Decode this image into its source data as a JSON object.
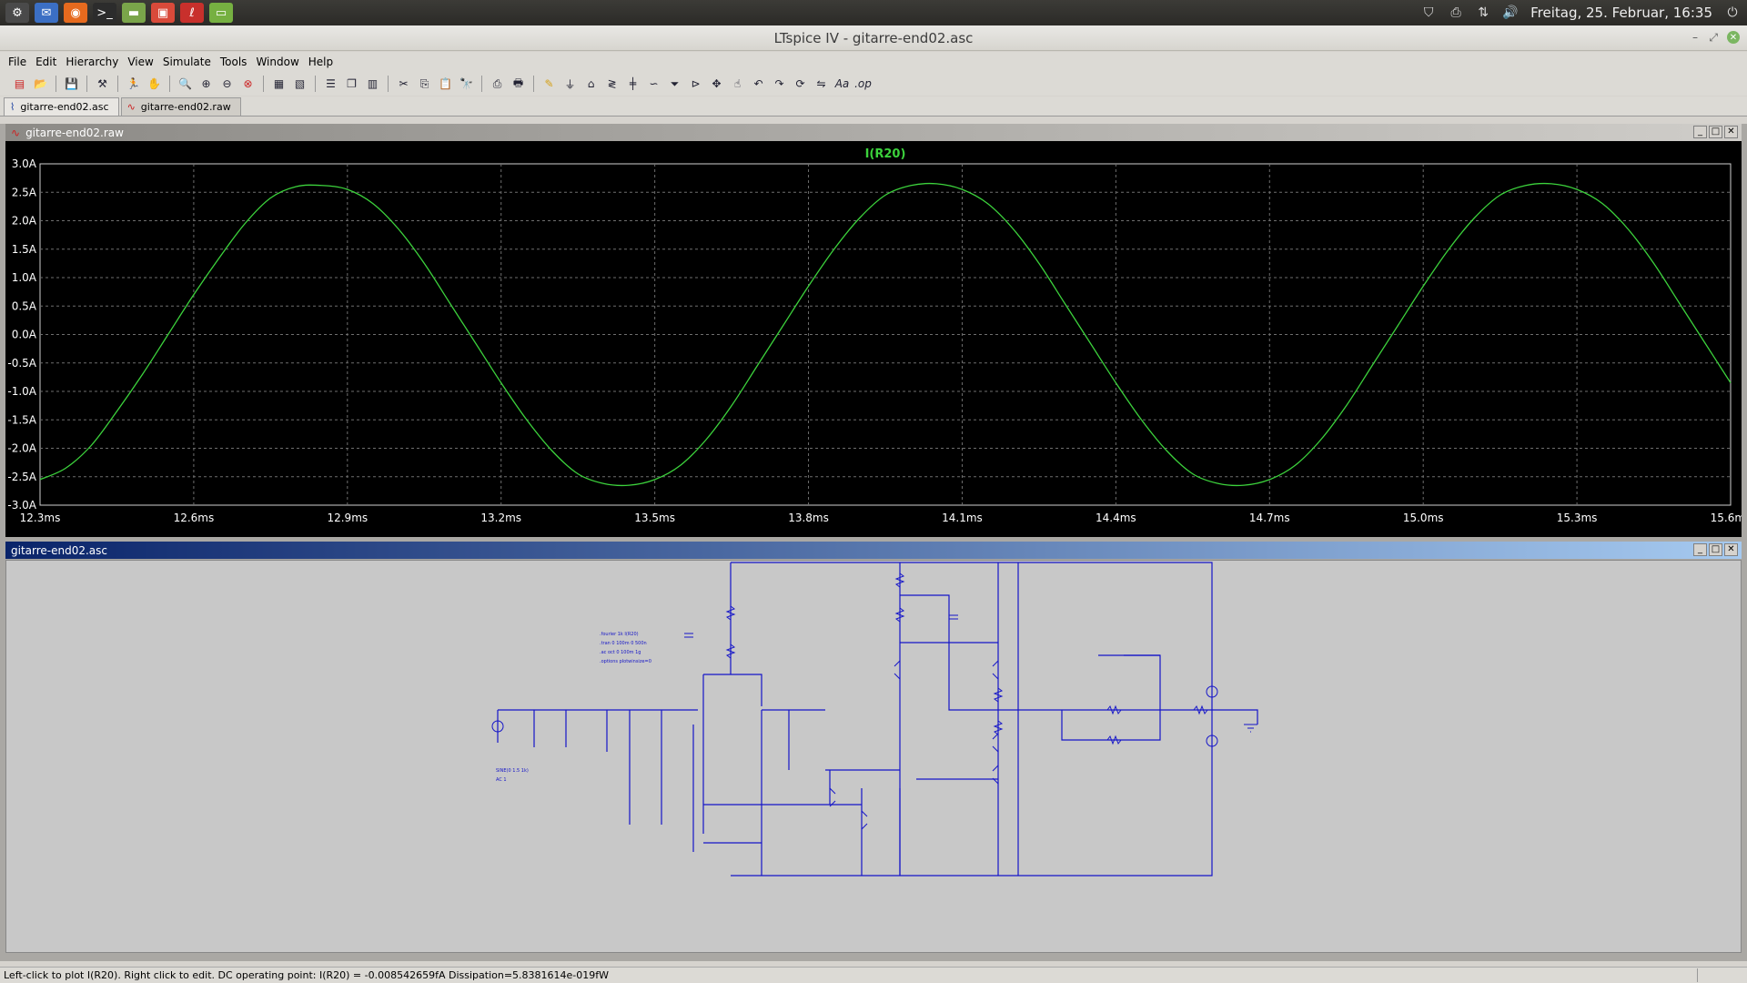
{
  "top_panel": {
    "launchers": [
      {
        "name": "system-settings-icon",
        "glyph": "⚙",
        "color": "#4a4a4a"
      },
      {
        "name": "mail-icon",
        "glyph": "✉",
        "color": "#3b6fc4"
      },
      {
        "name": "firefox-icon",
        "glyph": "◉",
        "color": "#e66a1e"
      },
      {
        "name": "terminal-icon",
        "glyph": ">_",
        "color": "#2c2c2c"
      },
      {
        "name": "files-icon",
        "glyph": "▬",
        "color": "#7aa54a"
      },
      {
        "name": "software-center-icon",
        "glyph": "▣",
        "color": "#d94a3a"
      },
      {
        "name": "ltspice-icon",
        "glyph": "ℓ",
        "color": "#c8302c"
      },
      {
        "name": "file-manager-icon",
        "glyph": "▭",
        "color": "#76b041"
      }
    ],
    "clock": "Freitag, 25. Februar, 16:35"
  },
  "window": {
    "title": "LTspice IV - gitarre-end02.asc",
    "minimize": "–",
    "restore": "⤢",
    "close": "✕"
  },
  "menu": [
    "File",
    "Edit",
    "Hierarchy",
    "View",
    "Simulate",
    "Tools",
    "Window",
    "Help"
  ],
  "tabs": [
    {
      "label": "gitarre-end02.asc",
      "icon": "schematic-icon",
      "glyph": "⌇"
    },
    {
      "label": "gitarre-end02.raw",
      "icon": "waveform-icon",
      "glyph": "∿"
    }
  ],
  "waveform_window": {
    "title": "gitarre-end02.raw",
    "trace_label": "I(R20)"
  },
  "schematic_window": {
    "title": "gitarre-end02.asc",
    "directives": [
      ".fourier 1k I(R20)",
      ".tran 0 100m 0 500n",
      ".ac oct 0 100m 1g",
      ".options plotwinsize=0"
    ],
    "source_lines": [
      "SINE(0 1.5 1k)",
      "AC 1"
    ]
  },
  "status": {
    "text": "Left-click to plot I(R20).  Right click to edit.  DC operating point: I(R20) = -0.008542659fA   Dissipation=5.8381614e-019fW"
  },
  "colors": {
    "trace": "#3cd23c",
    "grid": "#6e6e6e",
    "wire": "#1515c8",
    "label_green": "#3cd23c"
  },
  "chart_data": {
    "type": "line",
    "title": "I(R20)",
    "xlabel": "",
    "ylabel": "",
    "xlim": [
      12.3,
      15.6
    ],
    "ylim": [
      -3.0,
      3.0
    ],
    "x_ticks": [
      "12.3ms",
      "12.6ms",
      "12.9ms",
      "13.2ms",
      "13.5ms",
      "13.8ms",
      "14.1ms",
      "14.4ms",
      "14.7ms",
      "15.0ms",
      "15.3ms",
      "15.6ms"
    ],
    "y_ticks": [
      "3.0A",
      "2.5A",
      "2.0A",
      "1.5A",
      "1.0A",
      "0.5A",
      "0.0A",
      "-0.5A",
      "-1.0A",
      "-1.5A",
      "-2.0A",
      "-2.5A",
      "-3.0A"
    ],
    "grid": true,
    "series": [
      {
        "name": "I(R20)",
        "x": [
          12.3,
          12.35,
          12.4,
          12.45,
          12.5,
          12.55,
          12.6,
          12.65,
          12.7,
          12.75,
          12.8,
          12.85,
          12.9,
          12.95,
          13.0,
          13.05,
          13.1,
          13.15,
          13.2,
          13.25,
          13.3,
          13.35,
          13.4,
          13.45,
          13.5,
          13.55,
          13.6,
          13.65,
          13.7,
          13.75,
          13.8,
          13.85,
          13.9,
          13.95,
          14.0,
          14.05,
          14.1,
          14.15,
          14.2,
          14.25,
          14.3,
          14.35,
          14.4,
          14.45,
          14.5,
          14.55,
          14.6,
          14.65,
          14.7,
          14.75,
          14.8,
          14.85,
          14.9,
          14.95,
          15.0,
          15.05,
          15.1,
          15.15,
          15.2,
          15.25,
          15.3,
          15.35,
          15.4,
          15.45,
          15.5,
          15.55,
          15.6
        ],
        "y": [
          -2.55,
          -2.35,
          -1.95,
          -1.35,
          -0.7,
          0.0,
          0.7,
          1.35,
          1.95,
          2.4,
          2.6,
          2.62,
          2.55,
          2.3,
          1.85,
          1.25,
          0.55,
          -0.15,
          -0.85,
          -1.5,
          -2.05,
          -2.45,
          -2.62,
          -2.65,
          -2.55,
          -2.3,
          -1.85,
          -1.25,
          -0.55,
          0.15,
          0.85,
          1.5,
          2.05,
          2.45,
          2.62,
          2.65,
          2.55,
          2.3,
          1.85,
          1.25,
          0.55,
          -0.15,
          -0.85,
          -1.5,
          -2.05,
          -2.45,
          -2.62,
          -2.65,
          -2.55,
          -2.3,
          -1.85,
          -1.25,
          -0.55,
          0.15,
          0.85,
          1.5,
          2.05,
          2.45,
          2.62,
          2.65,
          2.55,
          2.3,
          1.85,
          1.25,
          0.55,
          -0.15,
          -0.85
        ]
      }
    ]
  }
}
